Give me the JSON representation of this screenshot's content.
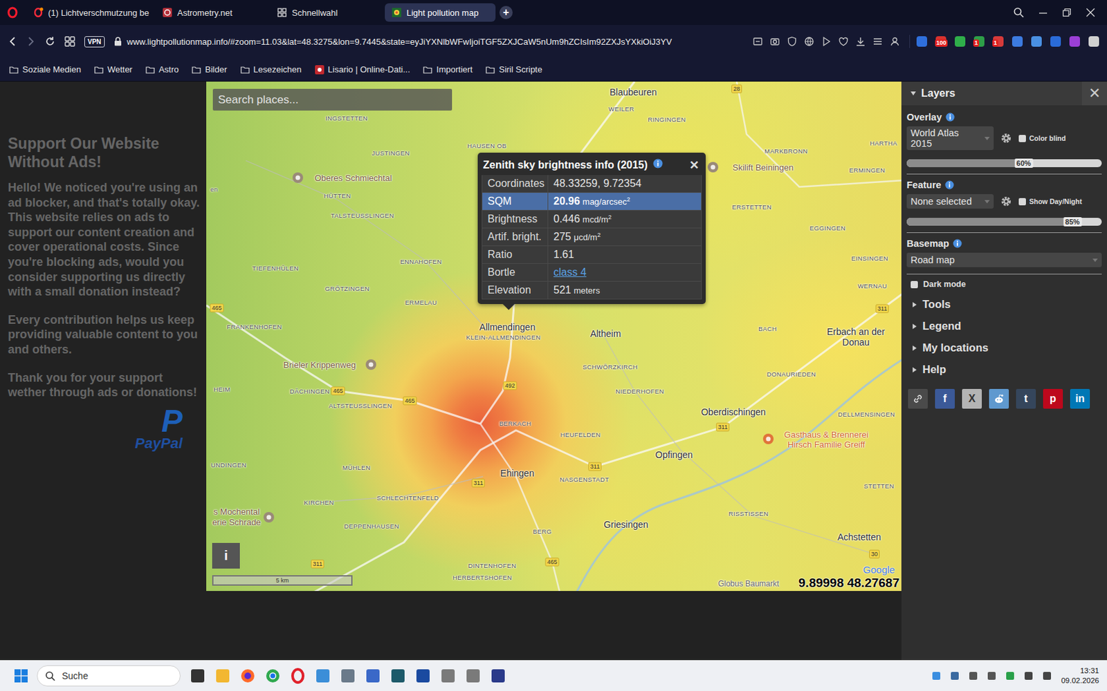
{
  "browser": {
    "tabs": [
      {
        "label": "(1) Lichtverschmutzung be",
        "selected": false,
        "kind": "forum"
      },
      {
        "label": "Astrometry.net",
        "selected": false,
        "kind": "astrometry"
      },
      {
        "label": "Schnellwahl",
        "selected": false,
        "kind": "speeddial"
      },
      {
        "label": "Light pollution map",
        "selected": true,
        "kind": "lpmap"
      }
    ],
    "new_tab": "+",
    "vpn": "VPN",
    "url": "www.lightpollutionmap.info/#zoom=11.03&lat=48.3275&lon=9.7445&state=eyJiYXNlbWFwIjoiTGF5ZXJCaW5nUm9hZCIsIm92ZXJsYXkiOiJ3YV",
    "extensions": [
      {
        "color": "#2f6fdc"
      },
      {
        "color": "#d8322e",
        "badge": "100"
      },
      {
        "color": "#2fae4a"
      },
      {
        "color": "#2e9e48",
        "badge": "1"
      },
      {
        "color": "#d63a3a",
        "badge": "1"
      },
      {
        "color": "#3c7be0"
      },
      {
        "color": "#4a90e2"
      },
      {
        "color": "#2a6bd8"
      },
      {
        "color": "#9b3fd6"
      },
      {
        "color": "#d0d0d0"
      }
    ],
    "bookmarks": [
      {
        "label": "Soziale Medien",
        "kind": "folder"
      },
      {
        "label": "Wetter",
        "kind": "folder"
      },
      {
        "label": "Astro",
        "kind": "folder"
      },
      {
        "label": "Bilder",
        "kind": "folder"
      },
      {
        "label": "Lesezeichen",
        "kind": "folder"
      },
      {
        "label": "Lisario | Online-Dati...",
        "kind": "site"
      },
      {
        "label": "Importiert",
        "kind": "folder"
      },
      {
        "label": "Siril Scripte",
        "kind": "folder"
      }
    ]
  },
  "ad_panel": {
    "title": "Support Our Website Without Ads!",
    "paragraphs": [
      "Hello! We noticed you're using an ad blocker, and that's totally okay. This website relies on ads to support our content creation and cover operational costs. Since you're blocking ads, would you consider supporting us directly with a small donation instead?",
      "Every contribution helps us keep providing valuable content to you and others.",
      "Thank you for your support wether through ads or donations!"
    ],
    "paypal_mark": "P",
    "paypal_text": "PayPal"
  },
  "map": {
    "search_placeholder": "Search places...",
    "labels": [
      {
        "text": "Blaubeuren",
        "kind": "town"
      },
      {
        "text": "WEILER",
        "kind": "village"
      },
      {
        "text": "RINGINGEN",
        "kind": "village"
      },
      {
        "text": "HAUSEN OB",
        "kind": "village"
      },
      {
        "text": "INGSTETTEN",
        "kind": "village"
      },
      {
        "text": "JUSTINGEN",
        "kind": "village"
      },
      {
        "text": "Oberes Schmiechtal",
        "kind": "poi"
      },
      {
        "text": "HÜTTEN",
        "kind": "village"
      },
      {
        "text": "TALSTEUSSLINGEN",
        "kind": "village"
      },
      {
        "text": "TIEFENHÜLEN",
        "kind": "village"
      },
      {
        "text": "ENNAHOFEN",
        "kind": "village"
      },
      {
        "text": "GRÖTZINGEN",
        "kind": "village"
      },
      {
        "text": "ERMELAU",
        "kind": "village"
      },
      {
        "text": "FRANKENHOFEN",
        "kind": "village"
      },
      {
        "text": "Allmendingen",
        "kind": "town"
      },
      {
        "text": "KLEIN-ALLMENDINGEN",
        "kind": "village"
      },
      {
        "text": "Altheim",
        "kind": "town"
      },
      {
        "text": "Brieler Krippenweg",
        "kind": "poi"
      },
      {
        "text": "SCHWÖRZKIRCH",
        "kind": "village"
      },
      {
        "text": "DÄCHINGEN",
        "kind": "village"
      },
      {
        "text": "ALTSTEUSSLINGEN",
        "kind": "village"
      },
      {
        "text": "BERKACH",
        "kind": "village"
      },
      {
        "text": "NIEDERHOFEN",
        "kind": "village"
      },
      {
        "text": "HEUFELDEN",
        "kind": "village"
      },
      {
        "text": "Oberdischingen",
        "kind": "town"
      },
      {
        "text": "Opfingen",
        "kind": "town"
      },
      {
        "text": "Ehingen",
        "kind": "town"
      },
      {
        "text": "NASGENSTADT",
        "kind": "village"
      },
      {
        "text": "MÜHLEN",
        "kind": "village"
      },
      {
        "text": "SCHLECHTENFELD",
        "kind": "village"
      },
      {
        "text": "KIRCHEN",
        "kind": "village"
      },
      {
        "text": "Griesingen",
        "kind": "town"
      },
      {
        "text": "BERG",
        "kind": "village"
      },
      {
        "text": "DEPPENHAUSEN",
        "kind": "village"
      },
      {
        "text": "DINTENHOFEN",
        "kind": "village"
      },
      {
        "text": "HERBERTSHOFEN",
        "kind": "village"
      },
      {
        "text": "Skilift Beiningen",
        "kind": "poi"
      },
      {
        "text": "MARKBRONN",
        "kind": "village"
      },
      {
        "text": "ERMINGEN",
        "kind": "village"
      },
      {
        "text": "ERSTETTEN",
        "kind": "village"
      },
      {
        "text": "EGGINGEN",
        "kind": "village"
      },
      {
        "text": "EINSINGEN",
        "kind": "village"
      },
      {
        "text": "WERNAU",
        "kind": "village"
      },
      {
        "text": "BACH",
        "kind": "village"
      },
      {
        "text": "Erbach an der Donau",
        "kind": "town"
      },
      {
        "text": "DONAURIEDEN",
        "kind": "village"
      },
      {
        "text": "DELLMENSINGEN",
        "kind": "village"
      },
      {
        "text": "Gasthaus & Brennerei Hirsch Familie Greiff",
        "kind": "food"
      },
      {
        "text": "RISSTISSEN",
        "kind": "village"
      },
      {
        "text": "STETTEN",
        "kind": "village"
      },
      {
        "text": "Achstetten",
        "kind": "town"
      },
      {
        "text": "s Mochental",
        "kind": "poi"
      },
      {
        "text": "erie Schrade",
        "kind": "poi"
      },
      {
        "text": "UNDINGEN",
        "kind": "village"
      },
      {
        "text": "HEIM",
        "kind": "village"
      },
      {
        "text": "en",
        "kind": "village"
      },
      {
        "text": "HARTHA",
        "kind": "village"
      },
      {
        "text": "Globus Baumarkt",
        "kind": "place"
      },
      {
        "text": "28",
        "kind": "road"
      },
      {
        "text": "465",
        "kind": "road"
      },
      {
        "text": "492",
        "kind": "road"
      },
      {
        "text": "465",
        "kind": "road"
      },
      {
        "text": "465",
        "kind": "road"
      },
      {
        "text": "311",
        "kind": "road"
      },
      {
        "text": "311",
        "kind": "road"
      },
      {
        "text": "311",
        "kind": "road"
      },
      {
        "text": "311",
        "kind": "road"
      },
      {
        "text": "465",
        "kind": "road"
      },
      {
        "text": "311",
        "kind": "road"
      },
      {
        "text": "30",
        "kind": "road"
      }
    ],
    "scale": "5 km",
    "info_button": "i",
    "attribution": "Google",
    "cursor_coords": "9.89998 48.27687",
    "popup": {
      "title": "Zenith sky brightness info (2015)",
      "close": "✕",
      "rows": [
        {
          "label": "Coordinates",
          "value": "48.33259, 9.72354",
          "selected": false,
          "kind": "text"
        },
        {
          "label": "SQM",
          "value": "20.96",
          "unit": "mag/arcsec",
          "exp": "2",
          "selected": true,
          "kind": "text"
        },
        {
          "label": "Brightness",
          "value": "0.446",
          "unit": "mcd/m",
          "exp": "2",
          "selected": false,
          "kind": "text"
        },
        {
          "label": "Artif. bright.",
          "value": "275",
          "unit": "μcd/m",
          "exp": "2",
          "selected": false,
          "kind": "text"
        },
        {
          "label": "Ratio",
          "value": "1.61",
          "selected": false,
          "kind": "text"
        },
        {
          "label": "Bortle",
          "value": "class 4",
          "selected": false,
          "kind": "link"
        },
        {
          "label": "Elevation",
          "value": "521",
          "unit": "meters",
          "selected": false,
          "kind": "text"
        }
      ]
    }
  },
  "layers_panel": {
    "header": {
      "label": "Layers",
      "expanded": true
    },
    "close": "✕",
    "overlay": {
      "label": "Overlay",
      "dropdown": "World Atlas 2015",
      "checkbox": {
        "label": "Color blind",
        "checked": false
      },
      "opacity": {
        "reading": "60%",
        "level": 0.6
      }
    },
    "feature": {
      "label": "Feature",
      "dropdown": "None selected",
      "checkbox": {
        "label": "Show Day/Night",
        "checked": false
      },
      "opacity": {
        "reading": "85%",
        "level": 0.85
      }
    },
    "basemap": {
      "label": "Basemap",
      "dropdown": "Road map"
    },
    "dark_mode": {
      "label": "Dark mode",
      "checked": false
    },
    "sections": [
      {
        "label": "Tools",
        "expanded": false
      },
      {
        "label": "Legend",
        "expanded": false
      },
      {
        "label": "My locations",
        "expanded": false
      },
      {
        "label": "Help",
        "expanded": false
      }
    ],
    "share_buttons": [
      {
        "kind": "link",
        "color": "#4a4a4a"
      },
      {
        "kind": "facebook",
        "glyph": "f",
        "color": "#3b5998"
      },
      {
        "kind": "x",
        "glyph": "X",
        "color": "#b4b4b4"
      },
      {
        "kind": "reddit",
        "color": "#5f99cf"
      },
      {
        "kind": "tumblr",
        "glyph": "t",
        "color": "#35465c"
      },
      {
        "kind": "pinterest",
        "glyph": "p",
        "color": "#bd081c"
      },
      {
        "kind": "linkedin",
        "glyph": "in",
        "color": "#0077b5"
      }
    ]
  },
  "taskbar": {
    "search": "Suche",
    "time": "13:31",
    "date": "09.02.2026"
  }
}
